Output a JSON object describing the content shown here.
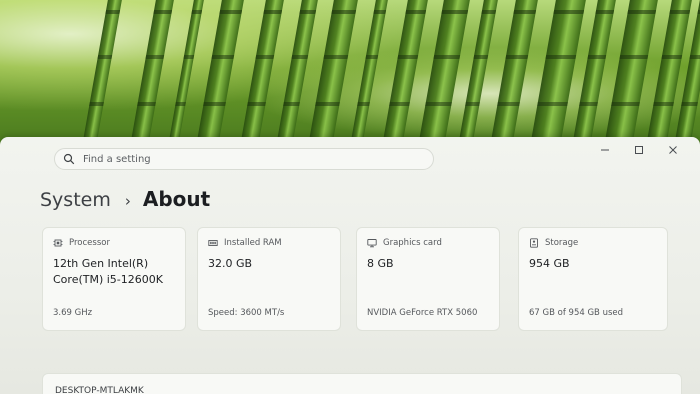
{
  "window": {
    "controls": {
      "minimize_glyph": "—",
      "maximize_glyph": "☐",
      "close_glyph": "✕"
    }
  },
  "search": {
    "placeholder": "Find a setting"
  },
  "breadcrumb": {
    "parent": "System",
    "separator": "›",
    "current": "About"
  },
  "cards": [
    {
      "label": "Processor",
      "icon": "processor-icon",
      "value_line1": "12th Gen Intel(R)",
      "value_line2": "Core(TM) i5-12600K",
      "detail": "3.69 GHz"
    },
    {
      "label": "Installed RAM",
      "icon": "memory-icon",
      "value_line1": "32.0 GB",
      "value_line2": "",
      "detail": "Speed: 3600 MT/s"
    },
    {
      "label": "Graphics card",
      "icon": "graphics-card-icon",
      "value_line1": "8 GB",
      "value_line2": "",
      "detail": "NVIDIA GeForce RTX 5060"
    },
    {
      "label": "Storage",
      "icon": "storage-icon",
      "value_line1": "954 GB",
      "value_line2": "",
      "detail": "67 GB of 954 GB used"
    }
  ],
  "device": {
    "name_partial": "DESKTOP-MTLAKMK"
  }
}
